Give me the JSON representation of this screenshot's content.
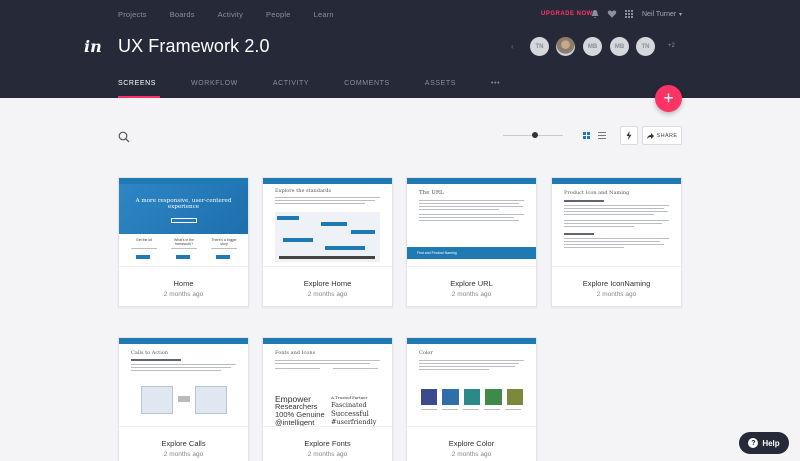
{
  "topnav": {
    "items": [
      "Projects",
      "Boards",
      "Activity",
      "People",
      "Learn"
    ]
  },
  "header": {
    "upgrade_label": "UPGRADE NOW",
    "user_name": "Neil Turner",
    "logo_text": "in",
    "project_title": "UX Framework 2.0",
    "prev_symbol": "‹",
    "more_count": "+2"
  },
  "collaborators": [
    "TN",
    "",
    "MB",
    "MB",
    "TN"
  ],
  "tabs": [
    "SCREENS",
    "WORKFLOW",
    "ACTIVITY",
    "COMMENTS",
    "ASSETS",
    "•••"
  ],
  "toolbar": {
    "share_label": "SHARE",
    "add_symbol": "+"
  },
  "screens": [
    {
      "name": "Home",
      "date": "2 months ago",
      "thumb": {
        "headline": "A more responsive, user-centered experience",
        "q1": "Get the kit",
        "q2": "What's in the framework?",
        "q3": "There's a bigger story"
      }
    },
    {
      "name": "Explore Home",
      "date": "2 months ago",
      "thumb": {
        "heading": "Explore the standards"
      }
    },
    {
      "name": "Explore URL",
      "date": "2 months ago",
      "thumb": {
        "heading": "The URL",
        "banner": "Find and Product Naming"
      }
    },
    {
      "name": "Explore IconNaming",
      "date": "2 months ago",
      "thumb": {
        "heading": "Product Icon and Naming"
      }
    },
    {
      "name": "Explore Calls",
      "date": "2 months ago",
      "thumb": {
        "heading": "Calls to Action"
      }
    },
    {
      "name": "Explore Fonts",
      "date": "2 months ago",
      "thumb": {
        "heading": "Fonts and Icons",
        "w1": "Empower",
        "w2": "Researchers",
        "w3": "100% Genuine",
        "w4": "@intelligent",
        "w5": "A Trusted Partner",
        "w6": "Fascinated",
        "w7": "Successful",
        "w8": "#userfriendly"
      }
    },
    {
      "name": "Explore Color",
      "date": "2 months ago",
      "thumb": {
        "heading": "Color"
      }
    }
  ],
  "swatch_colors": [
    "#3b4a8c",
    "#2f6ea8",
    "#2a8a8a",
    "#3f8a4a",
    "#7a8a3a"
  ],
  "colors": {
    "header": "#262a38",
    "accent": "#ff3366",
    "thumb_bar": "#1f7ab3"
  },
  "help": {
    "label": "Help",
    "symbol": "?"
  }
}
